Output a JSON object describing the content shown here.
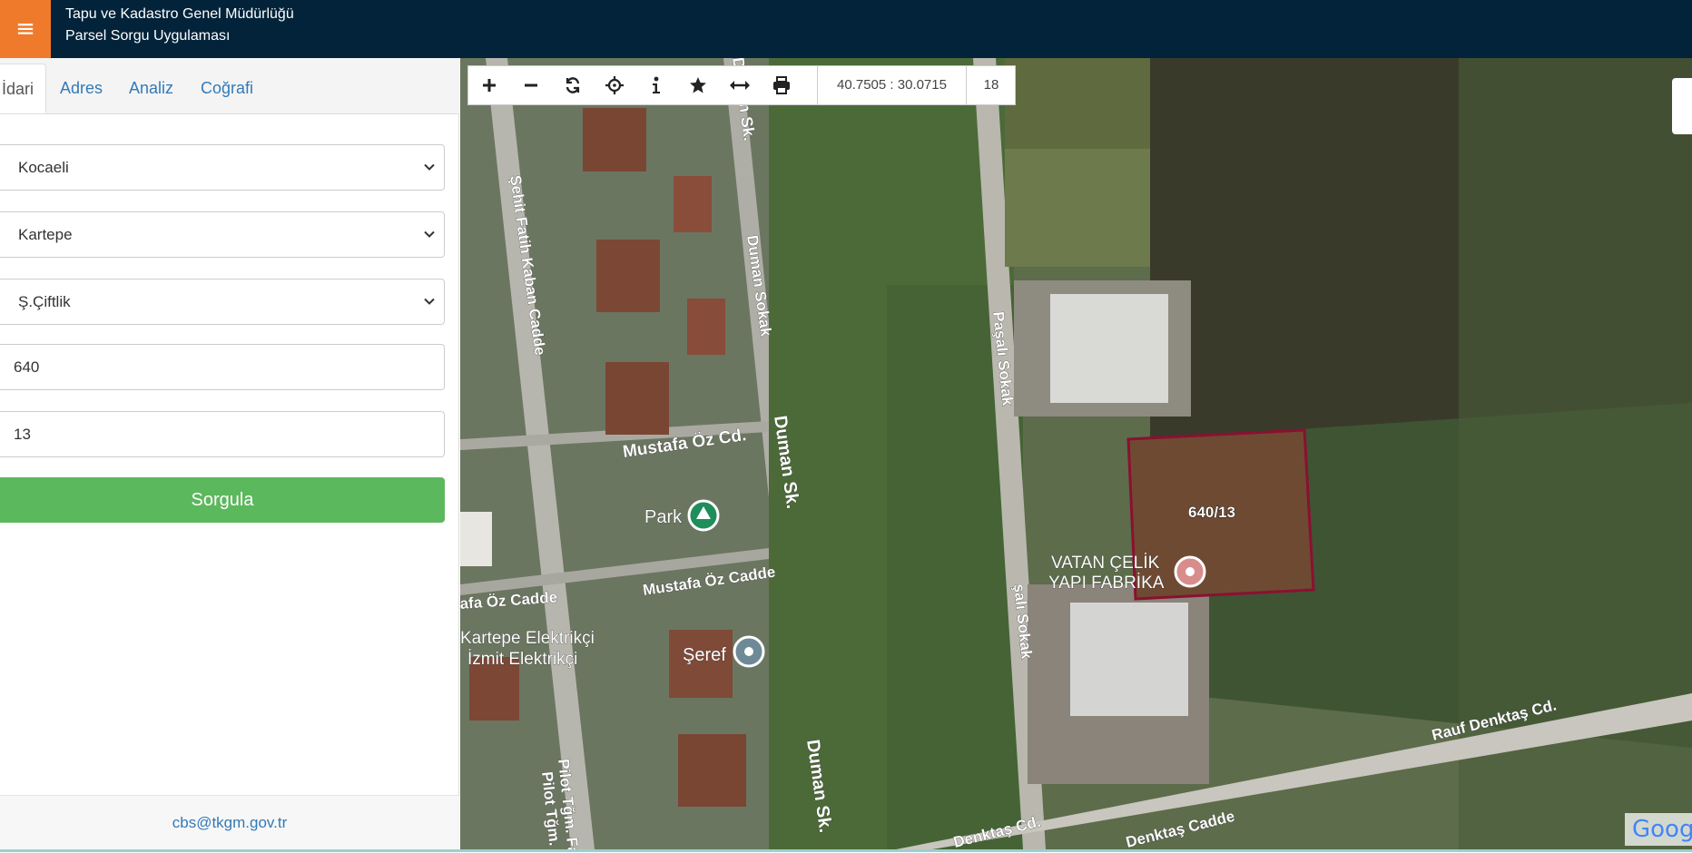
{
  "header": {
    "menu_icon": "hamburger-icon",
    "title_line1": "Tapu ve Kadastro Genel Müdürlüğü",
    "title_line2": "Parsel Sorgu Uygulaması",
    "colors": {
      "bar": "#022339",
      "menu_button": "#f07a2b"
    }
  },
  "sidebar": {
    "tabs": [
      {
        "label": "İdari",
        "active": true
      },
      {
        "label": "Adres"
      },
      {
        "label": "Analiz"
      },
      {
        "label": "Coğrafi"
      }
    ],
    "province": "Kocaeli",
    "district": "Kartepe",
    "neighborhood": "Ş.Çiftlik",
    "block": "640",
    "parcel": "13",
    "query_button": "Sorgula",
    "footer_email": "cbs@tkgm.gov.tr",
    "colors": {
      "query_button": "#5cb85c",
      "link": "#337ab7"
    }
  },
  "map": {
    "toolbar": {
      "icons": [
        "zoom-in-icon",
        "zoom-out-icon",
        "refresh-icon",
        "locate-icon",
        "info-icon",
        "star-icon",
        "measure-icon",
        "print-icon"
      ],
      "coordinates": "40.7505 : 30.0715",
      "zoom_level": "18"
    },
    "labels": {
      "street_sehit": "Şehit Fatih Kaban Cadde",
      "street_duman1": "Duman Sk.",
      "street_duman_sokak": "Duman Sokak",
      "street_duman2": "Duman Sk.",
      "street_duman3": "Duman Sk.",
      "street_mustafa_cd": "Mustafa Öz Cd.",
      "street_mustafa_cadde": "Mustafa Öz Cadde",
      "street_mustafa_cadde_left": "afa Öz Cadde",
      "poi_park": "Park",
      "poi_kartepe": "Kartepe Elektrikçi",
      "poi_izmit": "İzmit Elektrikçi",
      "poi_seref": "Şeref",
      "street_pilot1": "Pilot Tğm. Fatih",
      "street_pilot2": "Pilot Tğm. Fati",
      "street_pasali": "Paşalı Sokak",
      "street_pasali2": "şalı Sokak",
      "poi_vatan1": "VATAN ÇELİK",
      "poi_vatan2": "YAPI FABRİKA",
      "parcel_label": "640/13",
      "street_rauf": "Rauf Denktaş Cd.",
      "street_denktas_cd": "Denktaş Cd.",
      "street_denktas_cadde": "Denktaş Cadde",
      "attribution": "Goog"
    },
    "colors": {
      "parcel_outline": "#8b1030",
      "label_text": "#ffffff"
    }
  }
}
